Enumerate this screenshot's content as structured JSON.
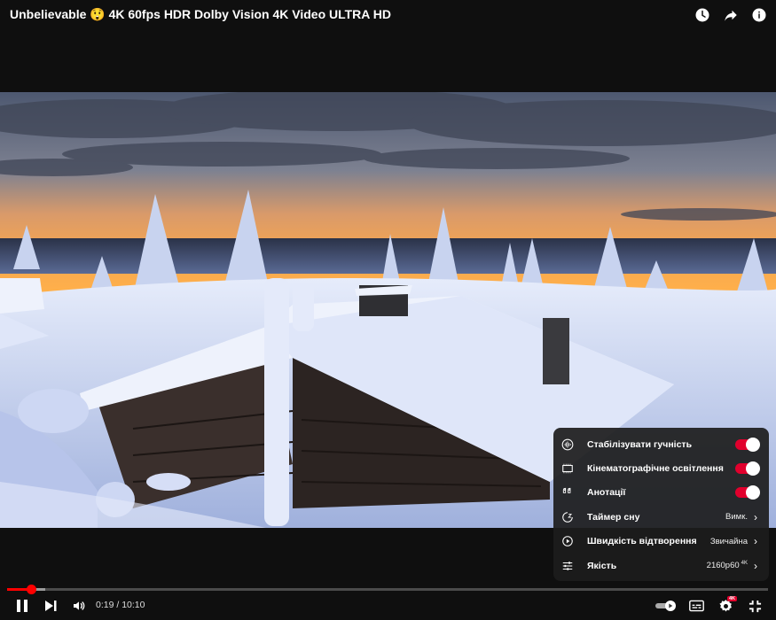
{
  "header": {
    "title": "Unbelievable 😲 4K 60fps HDR Dolby Vision 4K Video ULTRA HD",
    "icons": [
      "clock-icon",
      "share-icon",
      "info-icon"
    ]
  },
  "settings_menu": {
    "items": [
      {
        "label": "Стабілізувати гучність",
        "icon": "waveform-icon",
        "toggle": true
      },
      {
        "label": "Кінематографічне освітлення",
        "icon": "ambient-screen-icon",
        "toggle": true
      },
      {
        "label": "Анотації",
        "icon": "annotations-icon",
        "toggle": true
      },
      {
        "label": "Таймер сну",
        "icon": "sleep-timer-icon",
        "value": "Вимк."
      },
      {
        "label": "Швидкість відтворення",
        "icon": "playback-speed-icon",
        "value": "Звичайна"
      },
      {
        "label": "Якість",
        "icon": "quality-sliders-icon",
        "value": "2160p60",
        "badge": "4K"
      }
    ]
  },
  "player": {
    "current_time": "0:19",
    "separator": " / ",
    "duration": "10:10",
    "played_fraction": 0.031,
    "buffered_fraction": 0.05,
    "badge": "4K",
    "accent_color": "#ff0000"
  }
}
